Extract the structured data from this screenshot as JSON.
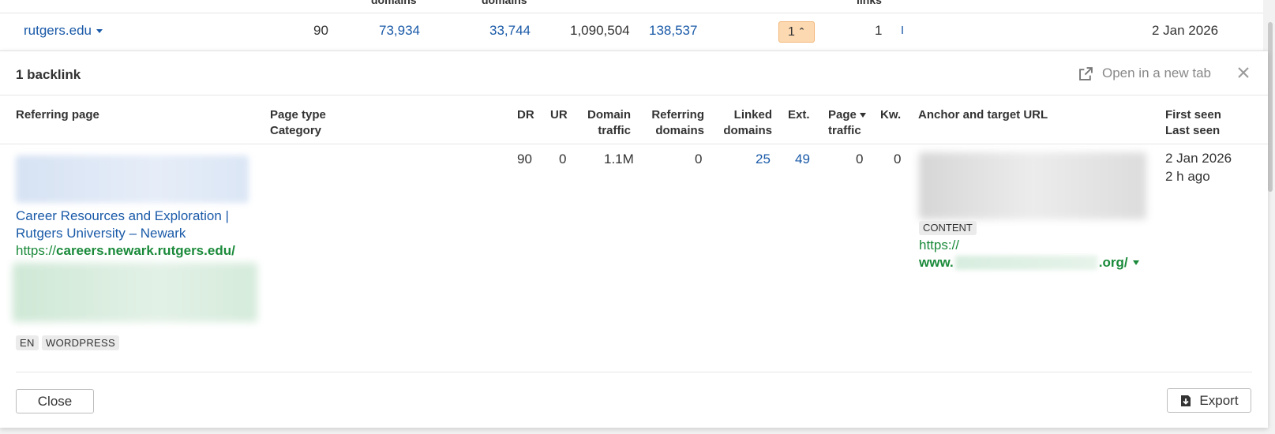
{
  "background_row": {
    "header_fragments": [
      "domains",
      "domains",
      "links"
    ],
    "domain": "rutgers.edu",
    "dr": "90",
    "col1": "73,934",
    "col2": "33,744",
    "col3": "1,090,504",
    "col4": "138,537",
    "badge": "1",
    "links": "1",
    "date": "2 Jan 2026"
  },
  "panel": {
    "title": "1 backlink",
    "open_new_tab": "Open in a new tab"
  },
  "columns": {
    "referring_page": "Referring page",
    "page_type": "Page type",
    "category": "Category",
    "dr": "DR",
    "ur": "UR",
    "domain_traffic_1": "Domain",
    "domain_traffic_2": "traffic",
    "ref_domains_1": "Referring",
    "ref_domains_2": "domains",
    "linked_domains_1": "Linked",
    "linked_domains_2": "domains",
    "ext": "Ext.",
    "page_traffic_1": "Page",
    "page_traffic_2": "traffic",
    "kw": "Kw.",
    "anchor": "Anchor and target URL",
    "first_seen": "First seen",
    "last_seen": "Last seen"
  },
  "row": {
    "page_title": "Career Resources and Exploration | Rutgers University – Newark",
    "url_prefix": "https://",
    "url_host": "careers.newark.rutgers.edu/",
    "tags": [
      "EN",
      "WORDPRESS"
    ],
    "dr": "90",
    "ur": "0",
    "domain_traffic": "1.1M",
    "ref_domains": "0",
    "linked_domains": "25",
    "ext": "49",
    "page_traffic": "0",
    "kw": "0",
    "anchor_tag": "CONTENT",
    "target_prefix": "https://",
    "target_host_start": "www.",
    "target_host_end": ".org/",
    "first_seen": "2 Jan 2026",
    "last_seen": "2 h ago"
  },
  "footer": {
    "close": "Close",
    "export": "Export"
  },
  "colors": {
    "link": "#1a5aa8",
    "url_green": "#1a8a3a",
    "badge_orange": "#fcd9b1"
  }
}
